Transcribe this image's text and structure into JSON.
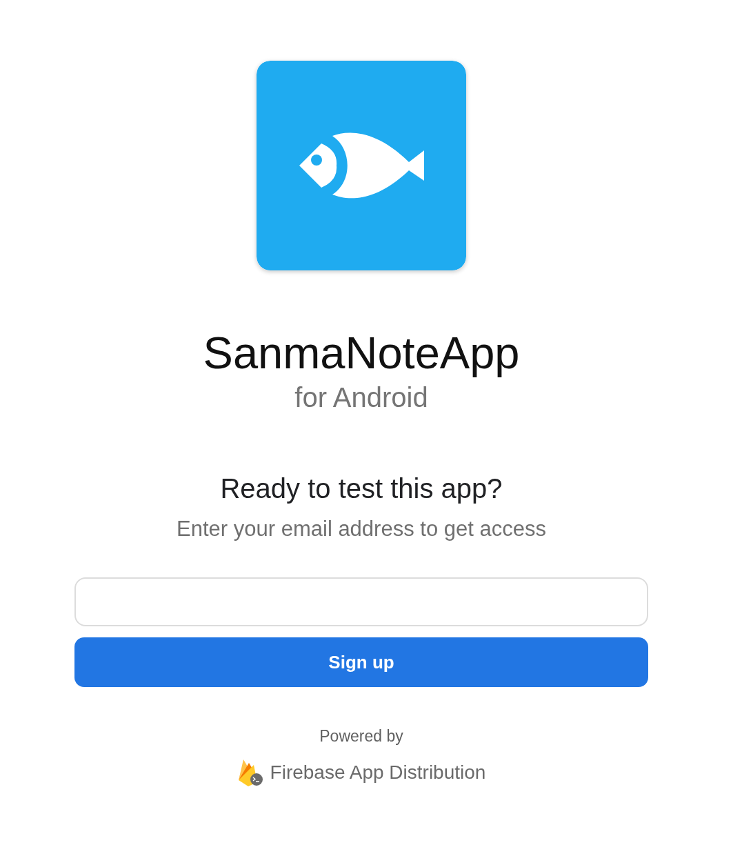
{
  "app": {
    "name": "SanmaNoteApp",
    "platform": "for Android"
  },
  "prompt": {
    "heading": "Ready to test this app?",
    "subheading": "Enter your email address to get access"
  },
  "signup_button": {
    "label": "Sign up"
  },
  "footer": {
    "powered_by": "Powered by",
    "product": "Firebase App Distribution"
  }
}
